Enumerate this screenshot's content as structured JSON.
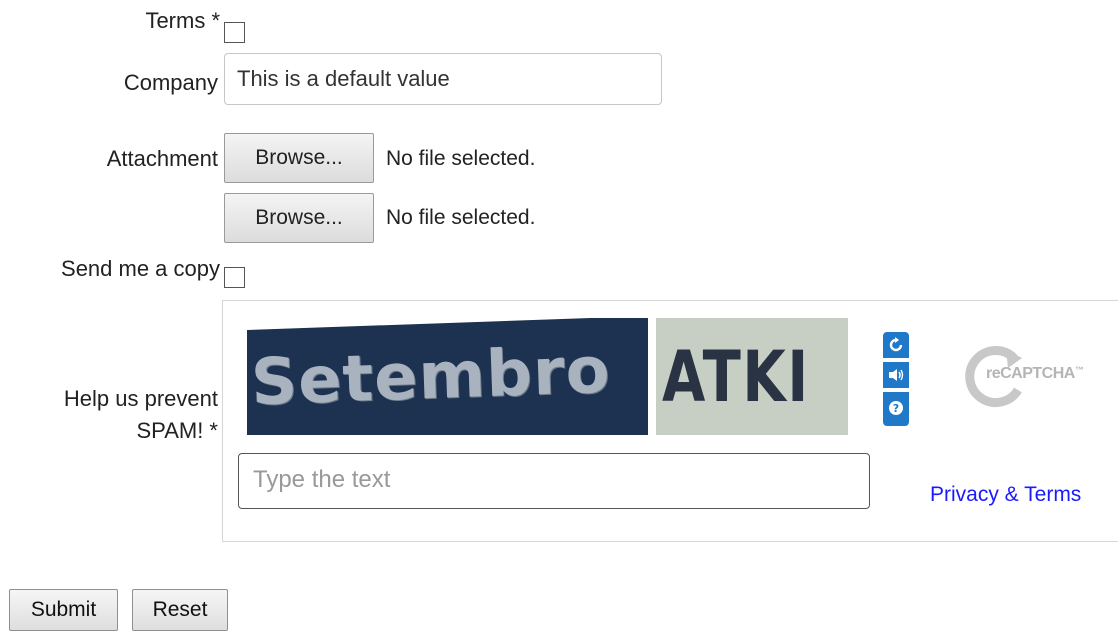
{
  "form": {
    "terms_label": "Terms *",
    "company_label": "Company",
    "company_value": "This is a default value",
    "attachment_label": "Attachment",
    "browse_label": "Browse...",
    "no_file_text": "No file selected.",
    "send_copy_label": "Send me a copy",
    "spam_label_line1": "Help us prevent",
    "spam_label_line2": "SPAM! *"
  },
  "captcha": {
    "challenge_word1": "Setembro",
    "challenge_word2": "ATKI",
    "input_placeholder": "Type the text",
    "privacy_link": "Privacy & Terms",
    "logo_text": "reCAPTCHA",
    "logo_tm": "™",
    "icons": [
      "refresh-icon",
      "audio-icon",
      "help-icon"
    ]
  },
  "buttons": {
    "submit": "Submit",
    "reset": "Reset"
  }
}
